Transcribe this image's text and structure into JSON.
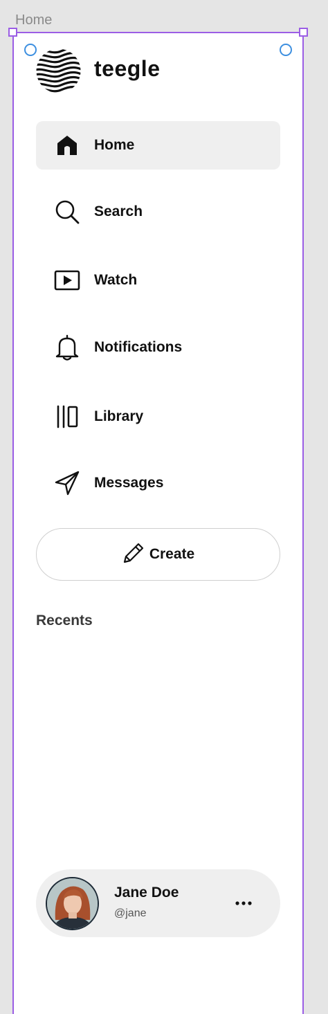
{
  "frame": {
    "label": "Home"
  },
  "brand": {
    "name": "teegle",
    "logo_icon": "wave-lines-logo"
  },
  "nav": {
    "items": [
      {
        "label": "Home",
        "icon": "home-icon",
        "active": true
      },
      {
        "label": "Search",
        "icon": "search-icon",
        "active": false
      },
      {
        "label": "Watch",
        "icon": "play-icon",
        "active": false
      },
      {
        "label": "Notifications",
        "icon": "bell-icon",
        "active": false
      },
      {
        "label": "Library",
        "icon": "library-icon",
        "active": false
      },
      {
        "label": "Messages",
        "icon": "paper-plane-icon",
        "active": false
      }
    ]
  },
  "create": {
    "label": "Create",
    "icon": "pencil-icon"
  },
  "recents": {
    "heading": "Recents"
  },
  "profile": {
    "name": "Jane Doe",
    "handle": "@jane",
    "more_icon": "more-horizontal-icon"
  },
  "colors": {
    "selection": "#9b5de5",
    "handle_circle": "#3d8fe0",
    "active_bg": "#efefef",
    "text": "#111111"
  }
}
